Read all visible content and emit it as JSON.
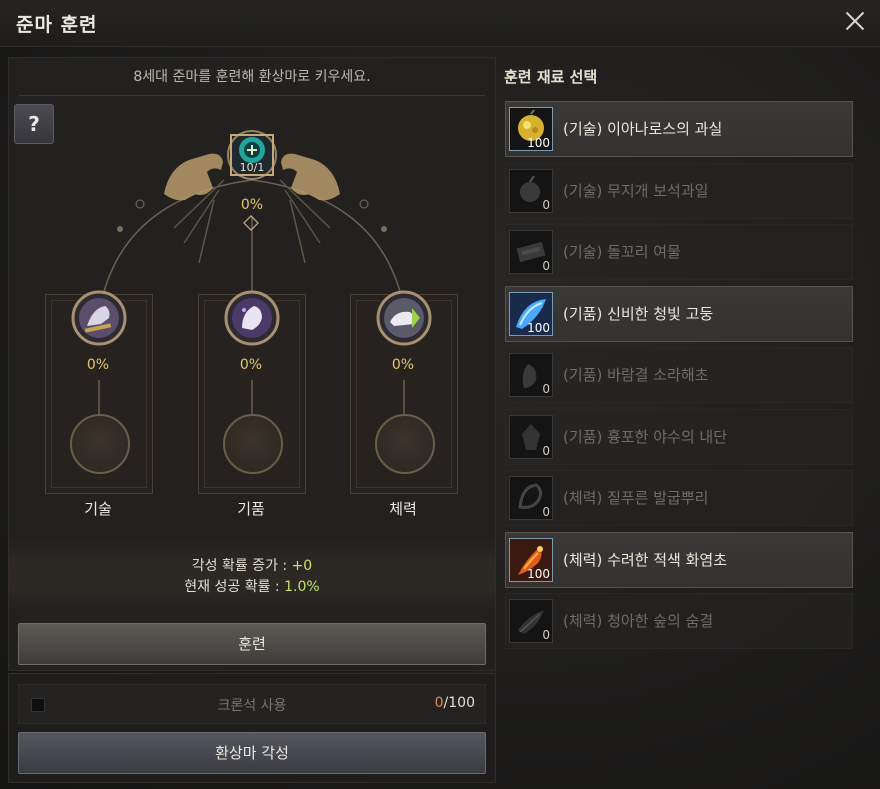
{
  "window": {
    "title": "준마 훈련"
  },
  "left": {
    "instruction": "8세대 준마를 훈련해 환상마로 키우세요.",
    "help_label": "?",
    "stack": "10/1",
    "top_percent": "0%",
    "stats": [
      {
        "name": "기술",
        "percent": "0%"
      },
      {
        "name": "기품",
        "percent": "0%"
      },
      {
        "name": "체력",
        "percent": "0%"
      }
    ],
    "awaken_increase_label": "각성 확률 증가 : ",
    "awaken_increase_value": "+0",
    "success_rate_label": "현재 성공 확률 : ",
    "success_rate_value": "1.0%",
    "train_button": "훈련",
    "chronstone_label": "크론석 사용",
    "chronstone_current": "0",
    "chronstone_max": "/100",
    "awaken_button": "환상마 각성"
  },
  "right": {
    "header": "훈련 재료 선택",
    "materials": [
      {
        "name": "(기술) 이아나로스의 과실",
        "count": "100",
        "active": true
      },
      {
        "name": "(기술) 무지개 보석과일",
        "count": "0",
        "active": false
      },
      {
        "name": "(기술) 돌꼬리 여물",
        "count": "0",
        "active": false
      },
      {
        "name": "(기품) 신비한 청빛 고둥",
        "count": "100",
        "active": true
      },
      {
        "name": "(기품) 바람결 소라해초",
        "count": "0",
        "active": false
      },
      {
        "name": "(기품) 흉포한 야수의 내단",
        "count": "0",
        "active": false
      },
      {
        "name": "(체력) 짙푸른 발굽뿌리",
        "count": "0",
        "active": false
      },
      {
        "name": "(체력) 수려한 적색 화염초",
        "count": "100",
        "active": true
      },
      {
        "name": "(체력) 청아한 숲의 숨결",
        "count": "0",
        "active": false
      }
    ]
  },
  "colors": {
    "accent_gold": "#e7c66a",
    "value_green": "#c5e26a",
    "count_orange": "#e58a4a"
  }
}
